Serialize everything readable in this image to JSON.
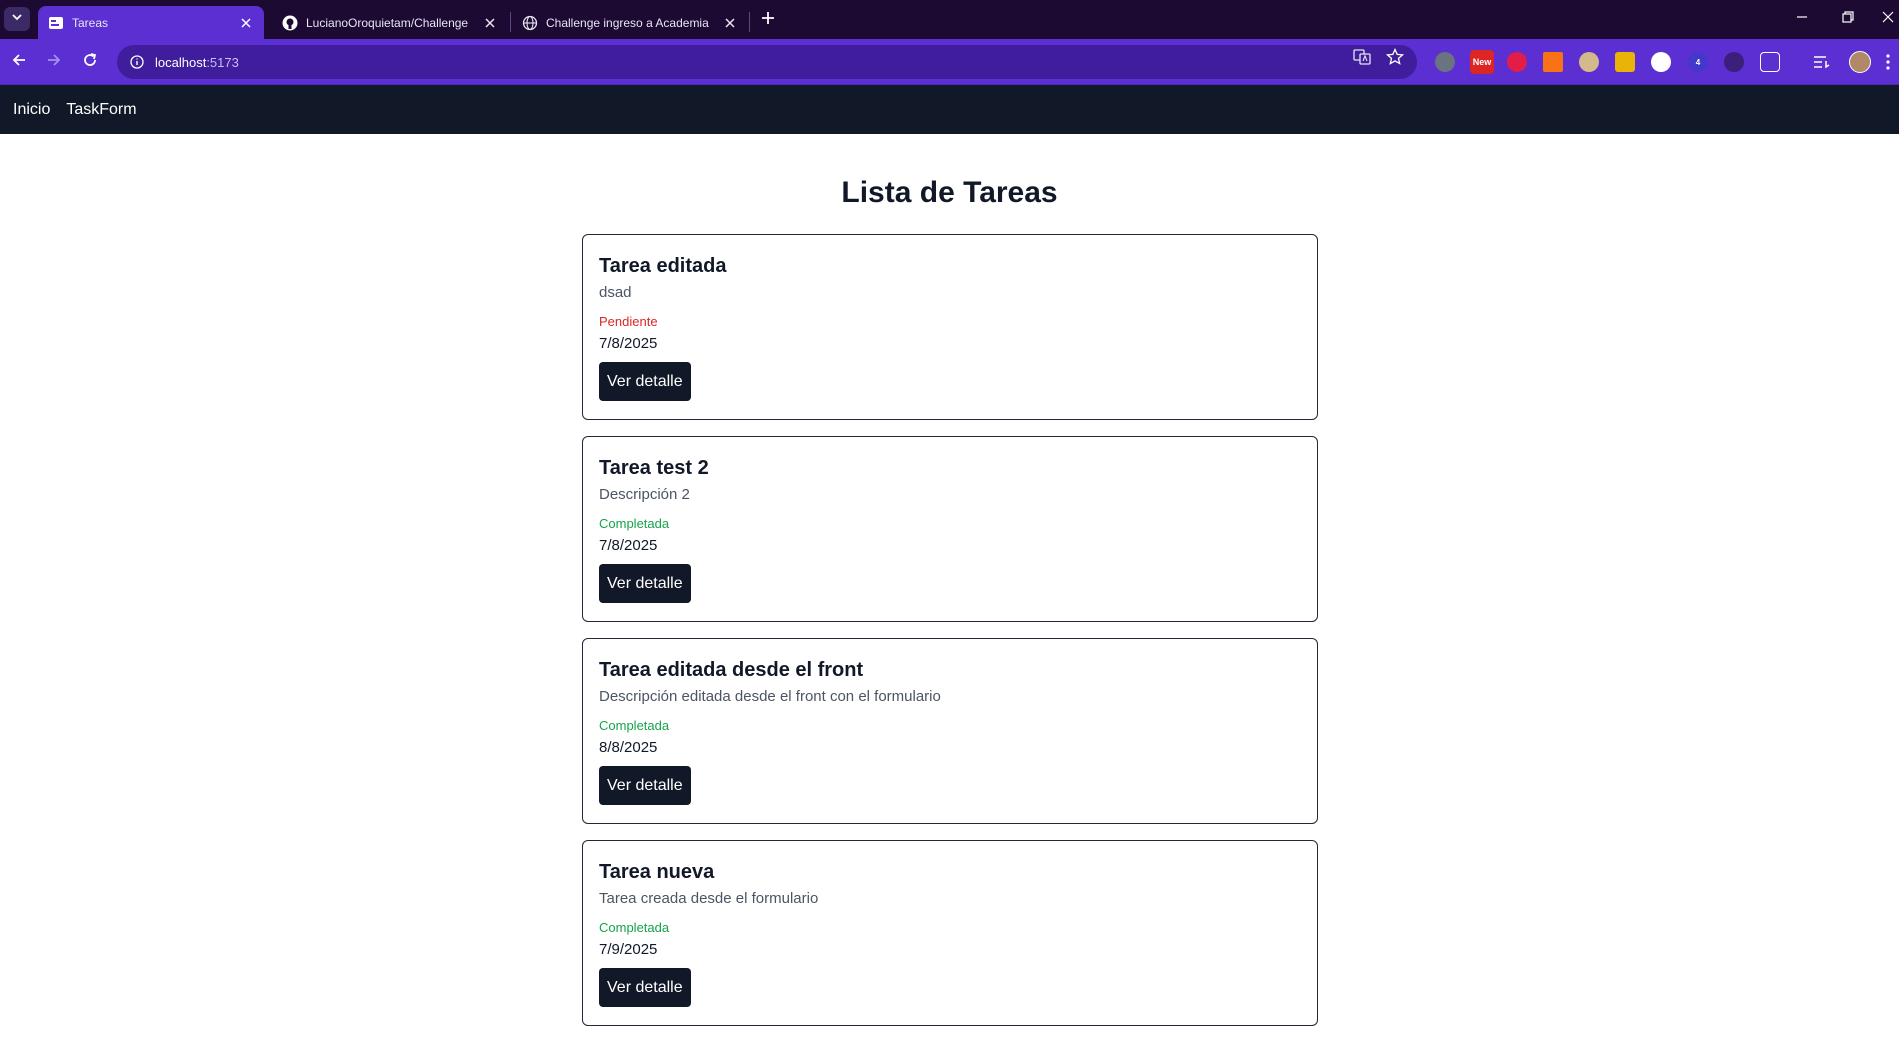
{
  "browser": {
    "tabs": [
      {
        "title": "Tareas",
        "active": true
      },
      {
        "title": "LucianoOroquietam/Challenge",
        "active": false
      },
      {
        "title": "Challenge ingreso a Academia",
        "active": false
      }
    ],
    "address": {
      "host": "localhost",
      "port": ":5173"
    },
    "extension_badges": {
      "new": "New",
      "count": "4"
    },
    "colors": {
      "tabbar": "#1c0a33",
      "toolbar": "#5b2fd1",
      "omnibox": "#3f1d9c"
    }
  },
  "nav": {
    "links": [
      "Inicio",
      "TaskForm"
    ]
  },
  "page": {
    "title": "Lista de Tareas"
  },
  "tasks": [
    {
      "title": "Tarea editada",
      "description": "dsad",
      "status": "Pendiente",
      "date": "7/8/2025",
      "button": "Ver detalle"
    },
    {
      "title": "Tarea test 2",
      "description": "Descripción 2",
      "status": "Completada",
      "date": "7/8/2025",
      "button": "Ver detalle"
    },
    {
      "title": "Tarea editada desde el front",
      "description": "Descripción editada desde el front con el formulario",
      "status": "Completada",
      "date": "8/8/2025",
      "button": "Ver detalle"
    },
    {
      "title": "Tarea nueva",
      "description": "Tarea creada desde el formulario",
      "status": "Completada",
      "date": "7/9/2025",
      "button": "Ver detalle"
    }
  ],
  "colors": {
    "nav_bg": "#111827",
    "pending": "#dc2626",
    "completed": "#16a34a",
    "button_bg": "#111827"
  }
}
